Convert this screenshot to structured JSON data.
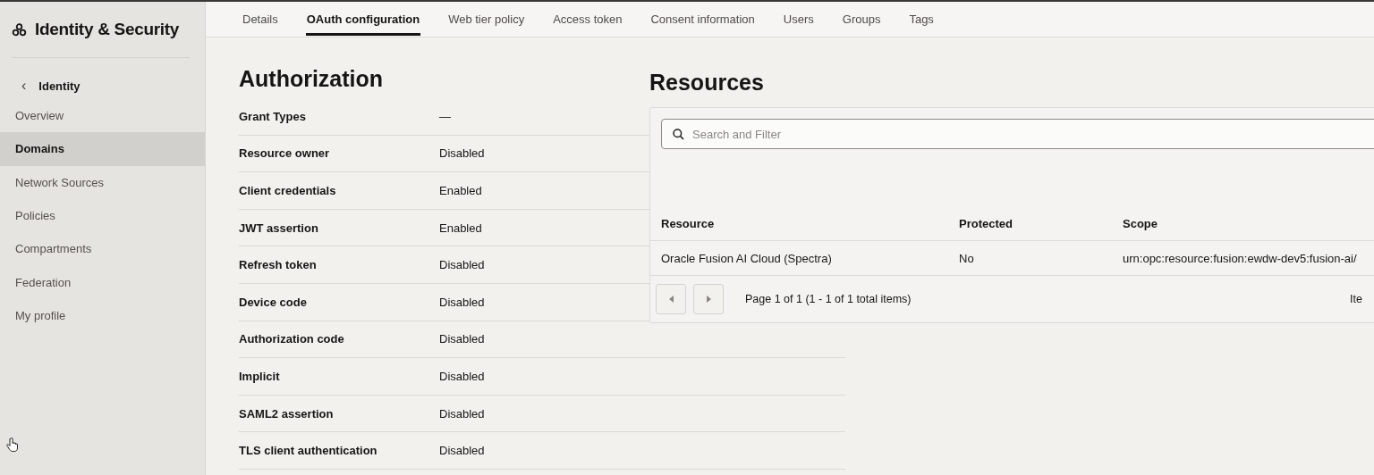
{
  "sidebar": {
    "title": "Identity & Security",
    "back": {
      "icon": "‹",
      "label": "Identity"
    },
    "items": [
      {
        "label": "Overview",
        "selected": false
      },
      {
        "label": "Domains",
        "selected": true
      },
      {
        "label": "Network Sources",
        "selected": false
      },
      {
        "label": "Policies",
        "selected": false
      },
      {
        "label": "Compartments",
        "selected": false
      },
      {
        "label": "Federation",
        "selected": false
      },
      {
        "label": "My profile",
        "selected": false
      }
    ]
  },
  "tabs": [
    {
      "label": "Details",
      "selected": false
    },
    {
      "label": "OAuth configuration",
      "selected": true
    },
    {
      "label": "Web tier policy",
      "selected": false
    },
    {
      "label": "Access token",
      "selected": false
    },
    {
      "label": "Consent information",
      "selected": false
    },
    {
      "label": "Users",
      "selected": false
    },
    {
      "label": "Groups",
      "selected": false
    },
    {
      "label": "Tags",
      "selected": false
    }
  ],
  "authorization": {
    "title": "Authorization",
    "rows": [
      {
        "label": "Grant Types",
        "value": "—"
      },
      {
        "label": "Resource owner",
        "value": "Disabled"
      },
      {
        "label": "Client credentials",
        "value": "Enabled"
      },
      {
        "label": "JWT assertion",
        "value": "Enabled"
      },
      {
        "label": "Refresh token",
        "value": "Disabled"
      },
      {
        "label": "Device code",
        "value": "Disabled"
      },
      {
        "label": "Authorization code",
        "value": "Disabled"
      },
      {
        "label": "Implicit",
        "value": "Disabled"
      },
      {
        "label": "SAML2 assertion",
        "value": "Disabled"
      },
      {
        "label": "TLS client authentication",
        "value": "Disabled"
      }
    ]
  },
  "resources": {
    "title": "Resources",
    "search": {
      "placeholder": "Search and Filter"
    },
    "table": {
      "columns": [
        "Resource",
        "Protected",
        "Scope"
      ],
      "rows": [
        [
          "Oracle Fusion AI Cloud (Spectra)",
          "No",
          "urn:opc:resource:fusion:ewdw-dev5:fusion-ai/"
        ]
      ]
    },
    "pagination": {
      "summary": "Page 1 of 1 (1 - 1 of 1 total items)",
      "trailing": "Ite"
    }
  }
}
